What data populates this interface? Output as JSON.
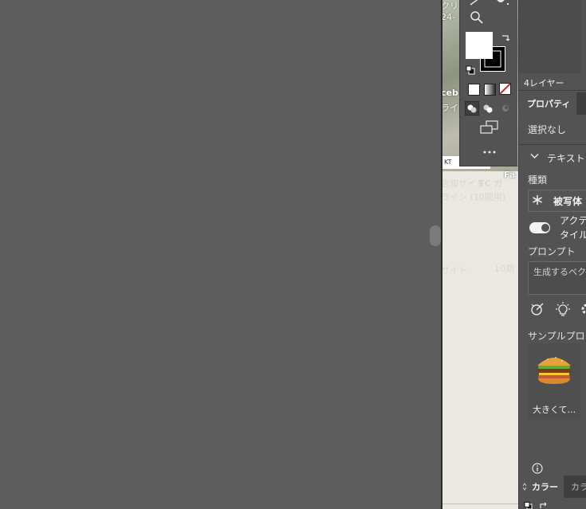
{
  "artboard": {
    "lines": [
      "クリ",
      "24-",
      "ceb",
      "ライ",
      "告知サイト",
      "TC ガ",
      "ライン (10期用)",
      "サイト",
      "10期",
      "Fa",
      "KT"
    ]
  },
  "panel": {
    "layers_count_label": "4レイヤー",
    "properties_tab": "プロパティ",
    "selection_status": "選択なし",
    "text_section_label": "テキスト",
    "kind_label": "種類",
    "subject_value": "被写体",
    "active_label": "アクテ",
    "tile_label": "タイル",
    "prompt_label": "プロンプト",
    "prompt_placeholder": "生成するベク",
    "sample_prompt_label": "サンプルプロン",
    "sample_item_label": "大きくて...",
    "color_tab": "カラー",
    "color_tab2": "カラ"
  },
  "icons": {
    "toolbar": [
      "pen-icon",
      "hand-icon",
      "zoom-icon",
      "swap-colors-icon",
      "default-colors-icon",
      "fill-color-swatch",
      "stroke-color-swatch",
      "color-mode-icon",
      "gradient-mode-icon",
      "none-mode-icon",
      "draw-normal-icon",
      "draw-behind-icon",
      "draw-inside-icon",
      "screen-mode-icon",
      "more-tools-icon"
    ],
    "panel": [
      "chevron-down-icon",
      "subject-icon",
      "pick-icon",
      "idea-icon",
      "settings-icon",
      "info-icon",
      "burger-thumbnail"
    ]
  },
  "colors": {
    "pasteboard": "#5d5d5d",
    "panel_bg": "#535353",
    "fill_swatch": "#ffffff",
    "stroke_swatch": "#000000",
    "none_mark": "#e01b24"
  }
}
